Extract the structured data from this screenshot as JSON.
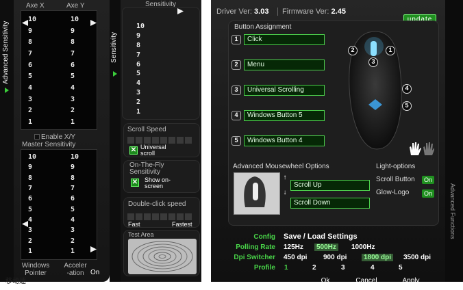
{
  "left_panel": {
    "tab_label": "Advanced Sensitivity",
    "axe_x": "Axe X",
    "axe_y": "Axe Y",
    "ticks": [
      "10",
      "9",
      "8",
      "7",
      "6",
      "5",
      "4",
      "3",
      "2",
      "1"
    ],
    "enable_xy": "Enable X/Y",
    "master_sensitivity": "Master Sensitivity",
    "windows_pointer": "Windows Pointer",
    "acceleration": "Acceler -ation",
    "acceleration_state": "On",
    "clipped_text": "移动速"
  },
  "middle_panel": {
    "tab_label": "Sensitivity",
    "sensitivity_header": "Sensitivity",
    "ticks": [
      "10",
      "9",
      "8",
      "7",
      "6",
      "5",
      "4",
      "3",
      "2",
      "1"
    ],
    "scroll_speed": "Scroll Speed",
    "universal_scroll": "Universal scroll",
    "on_the_fly": "On-The-Fly Sensitivity",
    "show_on_screen": "Show on-screen",
    "double_click": "Double-click speed",
    "fast": "Fast",
    "fastest": "Fastest",
    "test_area": "Test Area"
  },
  "main_panel": {
    "driver_label": "Driver Ver:",
    "driver_version": "3.03",
    "firmware_label": "Firmware Ver:",
    "firmware_version": "2.45",
    "update_button": "update",
    "button_assignment": "Button Assignment",
    "buttons": [
      {
        "num": "1",
        "action": "Click"
      },
      {
        "num": "2",
        "action": "Menu"
      },
      {
        "num": "3",
        "action": "Universal Scrolling"
      },
      {
        "num": "4",
        "action": "Windows Button 5"
      },
      {
        "num": "5",
        "action": "Windows Button 4"
      }
    ],
    "mouse_badges": [
      "2",
      "1",
      "3",
      "4",
      "5"
    ],
    "mousewheel_title": "Advanced Mousewheel Options",
    "scroll_up": "Scroll Up",
    "scroll_down": "Scroll Down",
    "light_options": "Light-options",
    "scroll_button": "Scroll Button",
    "scroll_button_state": "On",
    "glow_logo": "Glow-Logo",
    "glow_logo_state": "On",
    "side_tab": "Advanced Functions"
  },
  "config": {
    "config_label": "Config",
    "config_value": "Save / Load Settings",
    "polling_label": "Polling Rate",
    "polling_options": [
      "125Hz",
      "500Hz",
      "1000Hz"
    ],
    "polling_selected": "500Hz",
    "dpi_label": "Dpi Switcher",
    "dpi_options": [
      "450 dpi",
      "900 dpi",
      "1800 dpi",
      "3500 dpi"
    ],
    "dpi_selected": "1800 dpi",
    "profile_label": "Profile",
    "profiles": [
      "1",
      "2",
      "3",
      "4",
      "5"
    ],
    "profile_selected": "1"
  },
  "actions": {
    "ok": "Ok",
    "cancel": "Cancel",
    "apply": "Apply"
  },
  "colors": {
    "accent": "#3bcf3b",
    "background": "#1a1a1a"
  }
}
